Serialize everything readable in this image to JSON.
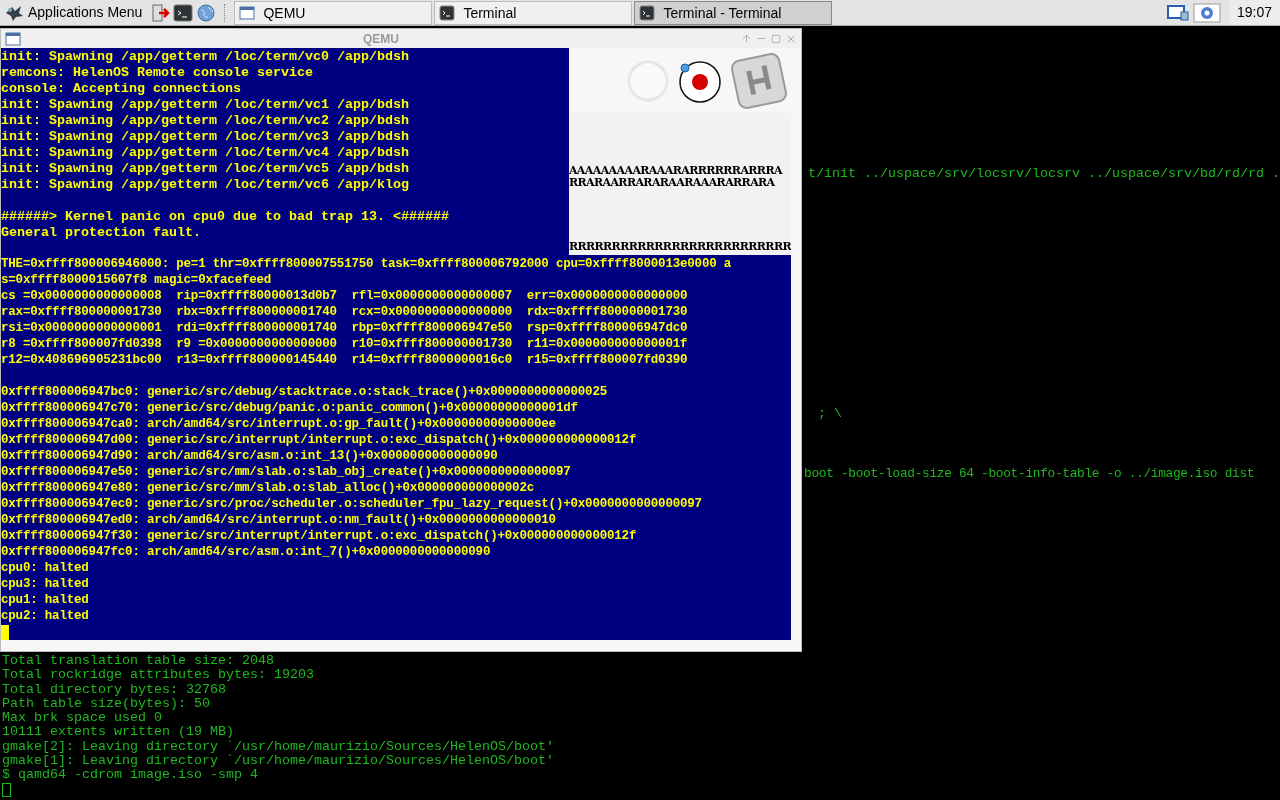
{
  "taskbar": {
    "menu_label": "Applications Menu",
    "tasks": [
      {
        "label": "QEMU",
        "kind": "window",
        "selected": false
      },
      {
        "label": "Terminal",
        "kind": "terminal",
        "selected": false
      },
      {
        "label": "Terminal - Terminal",
        "kind": "terminal",
        "selected": true
      }
    ],
    "clock": "19:07"
  },
  "terminal": {
    "right_lines": [
      "t/init ../uspace/srv/locsrv/locsrv ../uspace/srv/bd/rd/rd .",
      "; \\",
      "boot -boot-load-size 64 -boot-info-table -o ../image.iso dist"
    ],
    "bottom_lines": [
      "Total translation table size: 2048",
      "Total rockridge attributes bytes: 19203",
      "Total directory bytes: 32768",
      "Path table size(bytes): 50",
      "Max brk space used 0",
      "10111 extents written (19 MB)",
      "gmake[2]: Leaving directory `/usr/home/maurizio/Sources/HelenOS/boot'",
      "gmake[1]: Leaving directory `/usr/home/maurizio/Sources/HelenOS/boot'",
      "$ qamd64 -cdrom image.iso -smp 4"
    ]
  },
  "qemu": {
    "title": "QEMU",
    "glitch_rows": [
      "AAAAAAAAARAAARARRRRRRARRRA",
      "RRARAARRARARAARAAARARRARA",
      "RRRRRRRRRRRRRRRRRRRRRRRRRR"
    ],
    "top_blocks": [
      [
        "init: Spawning /app/getterm /loc/term/vc0 /app/bdsh",
        "remcons: HelenOS Remote console service",
        "console: Accepting connections",
        "init: Spawning /app/getterm /loc/term/vc1 /app/bdsh",
        "init: Spawning /app/getterm /loc/term/vc2 /app/bdsh",
        "init: Spawning /app/getterm /loc/term/vc3 /app/bdsh",
        "init: Spawning /app/getterm /loc/term/vc4 /app/bdsh",
        "init: Spawning /app/getterm /loc/term/vc5 /app/bdsh",
        "init: Spawning /app/getterm /loc/term/vc6 /app/klog"
      ],
      [
        "######> Kernel panic on cpu0 due to bad trap 13. <######",
        "General protection fault."
      ]
    ],
    "bottom_blocks": [
      [
        "THE=0xffff800006946000: pe=1 thr=0xffff800007551750 task=0xffff800006792000 cpu=0xffff8000013e0000 a",
        "s=0xffff8000015607f8 magic=0xfacefeed",
        "cs =0x0000000000000008  rip=0xffff80000013d0b7  rfl=0x0000000000000007  err=0x0000000000000000",
        "rax=0xffff800000001730  rbx=0xffff800000001740  rcx=0x0000000000000000  rdx=0xffff800000001730",
        "rsi=0x0000000000000001  rdi=0xffff800000001740  rbp=0xffff800006947e50  rsp=0xffff800006947dc0",
        "r8 =0xffff800007fd0398  r9 =0x0000000000000000  r10=0xffff800000001730  r11=0x000000000000001f",
        "r12=0x408696905231bc00  r13=0xffff800000145440  r14=0xffff8000000016c0  r15=0xffff800007fd0390"
      ],
      [
        "0xffff800006947bc0: generic/src/debug/stacktrace.o:stack_trace()+0x0000000000000025",
        "0xffff800006947c70: generic/src/debug/panic.o:panic_common()+0x00000000000001df",
        "0xffff800006947ca0: arch/amd64/src/interrupt.o:gp_fault()+0x00000000000000ee",
        "0xffff800006947d00: generic/src/interrupt/interrupt.o:exc_dispatch()+0x000000000000012f",
        "0xffff800006947d90: arch/amd64/src/asm.o:int_13()+0x0000000000000090",
        "0xffff800006947e50: generic/src/mm/slab.o:slab_obj_create()+0x0000000000000097",
        "0xffff800006947e80: generic/src/mm/slab.o:slab_alloc()+0x000000000000002c",
        "0xffff800006947ec0: generic/src/proc/scheduler.o:scheduler_fpu_lazy_request()+0x0000000000000097",
        "0xffff800006947ed0: arch/amd64/src/interrupt.o:nm_fault()+0x0000000000000010",
        "0xffff800006947f30: generic/src/interrupt/interrupt.o:exc_dispatch()+0x000000000000012f",
        "0xffff800006947fc0: arch/amd64/src/asm.o:int_7()+0x0000000000000090",
        "cpu0: halted",
        "cpu3: halted",
        "cpu1: halted",
        "cpu2: halted"
      ]
    ]
  }
}
